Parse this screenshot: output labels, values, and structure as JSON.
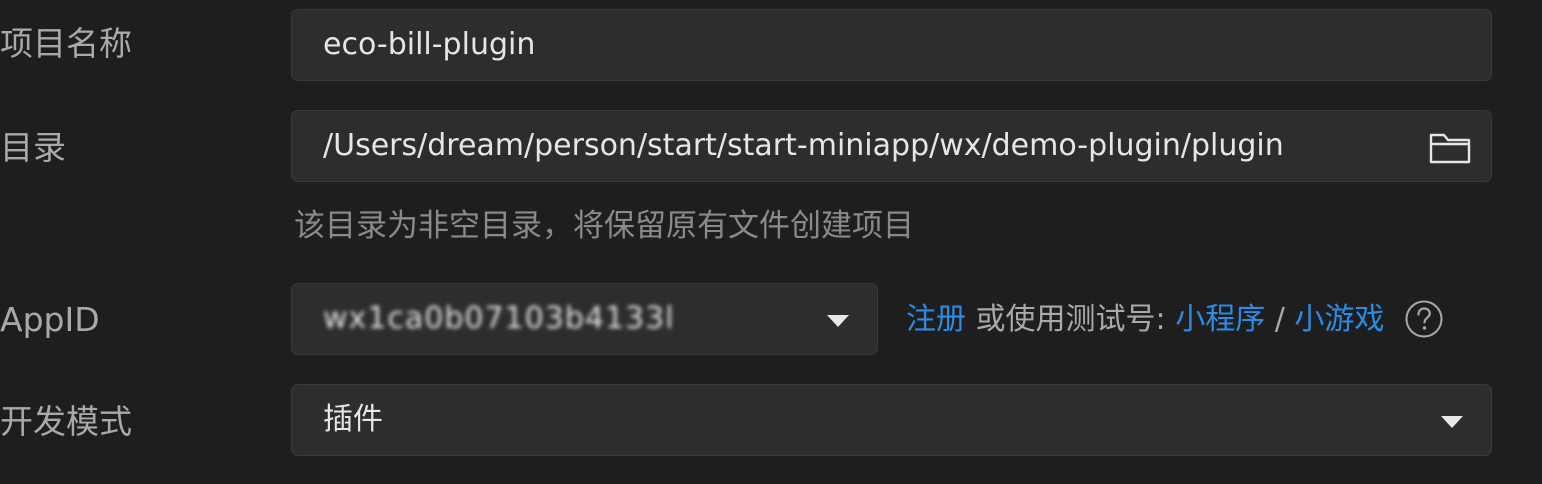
{
  "form": {
    "project_name": {
      "label": "项目名称",
      "value": "eco-bill-plugin"
    },
    "directory": {
      "label": "目录",
      "value": "/Users/dream/person/start/start-miniapp/wx/demo-plugin/plugin",
      "hint": "该目录为非空目录，将保留原有文件创建项目",
      "icon": "folder-icon"
    },
    "appid": {
      "label": "AppID",
      "value": "wx1ca0b07103b4133l",
      "register_link": "注册",
      "test_text": "或使用测试号:",
      "mini_program_link": "小程序",
      "separator": "/",
      "mini_game_link": "小游戏",
      "help_icon": "question-circle-icon"
    },
    "dev_mode": {
      "label": "开发模式",
      "value": "插件"
    }
  },
  "colors": {
    "background": "#1e1e1e",
    "field_background": "#2d2d2d",
    "link": "#2b8be6",
    "label": "#a9a9a9",
    "hint": "#8a8a8a"
  }
}
